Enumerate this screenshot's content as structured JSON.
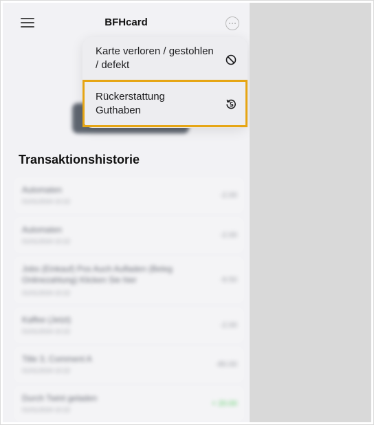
{
  "header": {
    "title": "BFHcard",
    "menu_icon": "hamburger-icon",
    "more_icon": "ellipsis-circle-icon"
  },
  "main": {
    "section_title": "Transaktionshistorie",
    "transactions": [
      {
        "title": "Automaten",
        "subtitle": "01/01/2024 10:22",
        "amount": "-2.00"
      },
      {
        "title": "Automaten",
        "subtitle": "01/01/2024 10:22",
        "amount": "-2.00"
      },
      {
        "title": "Jobs (Einkauf) Pos Auch  Aufladen  (Beleg Onlinezahlung)  Klicken  Sie hier",
        "subtitle": "01/01/2024 10:22",
        "amount": "-9.50"
      },
      {
        "title": "Kaffee (Jetzt)",
        "subtitle": "01/01/2024 10:22",
        "amount": "-2.00"
      },
      {
        "title": "Title 3, Comment A",
        "subtitle": "01/01/2024 10:22",
        "amount": "-80.00"
      },
      {
        "title": "Durch Twint geladen",
        "subtitle": "01/01/2024 10:22",
        "amount": "+ 20.00"
      }
    ]
  },
  "menu": {
    "items": [
      {
        "label": "Karte verloren / gestohlen / defekt",
        "icon": "prohibited-icon"
      },
      {
        "label": "Rückerstattung Guthaben",
        "icon": "refund-icon"
      }
    ]
  },
  "colors": {
    "highlight": "#e6a514",
    "side_panel": "#d9d9d9",
    "positive_amount": "#5fcf6c"
  }
}
